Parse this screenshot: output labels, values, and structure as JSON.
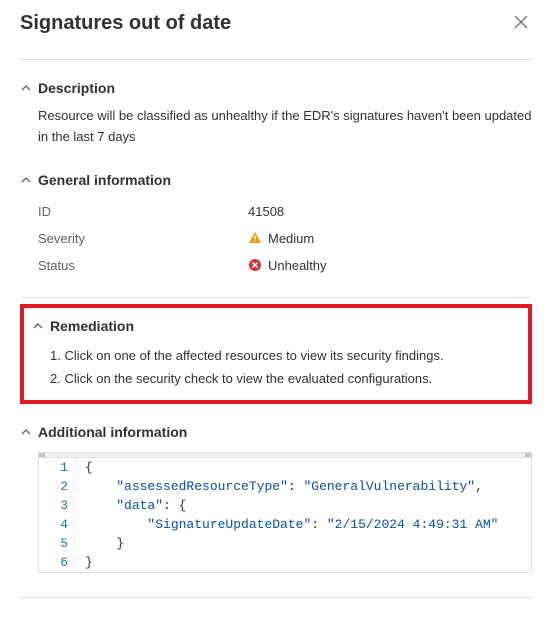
{
  "header": {
    "title": "Signatures out of date"
  },
  "sections": {
    "description": {
      "heading": "Description",
      "body": "Resource will be classified as unhealthy if the EDR's signatures haven't been updated in the last 7 days"
    },
    "general": {
      "heading": "General information",
      "rows": {
        "id": {
          "label": "ID",
          "value": "41508"
        },
        "severity": {
          "label": "Severity",
          "value": "Medium"
        },
        "status": {
          "label": "Status",
          "value": "Unhealthy"
        }
      }
    },
    "remediation": {
      "heading": "Remediation",
      "steps": [
        "1. Click on one of the affected resources to view its security findings.",
        "2. Click on the security check to view the evaluated configurations."
      ]
    },
    "additional": {
      "heading": "Additional information",
      "json": {
        "lines": [
          {
            "n": "1",
            "indent": "",
            "tokens": [
              [
                "brace",
                "{"
              ]
            ]
          },
          {
            "n": "2",
            "indent": "    ",
            "tokens": [
              [
                "key",
                "\"assessedResourceType\""
              ],
              [
                "colon",
                ": "
              ],
              [
                "str",
                "\"GeneralVulnerability\""
              ],
              [
                "colon",
                ","
              ]
            ]
          },
          {
            "n": "3",
            "indent": "    ",
            "tokens": [
              [
                "key",
                "\"data\""
              ],
              [
                "colon",
                ": "
              ],
              [
                "brace",
                "{"
              ]
            ]
          },
          {
            "n": "4",
            "indent": "        ",
            "tokens": [
              [
                "key",
                "\"SignatureUpdateDate\""
              ],
              [
                "colon",
                ": "
              ],
              [
                "str",
                "\"2/15/2024 4:49:31 AM\""
              ]
            ]
          },
          {
            "n": "5",
            "indent": "    ",
            "tokens": [
              [
                "brace",
                "}"
              ]
            ]
          },
          {
            "n": "6",
            "indent": "",
            "tokens": [
              [
                "brace",
                "}"
              ]
            ]
          }
        ]
      }
    }
  }
}
